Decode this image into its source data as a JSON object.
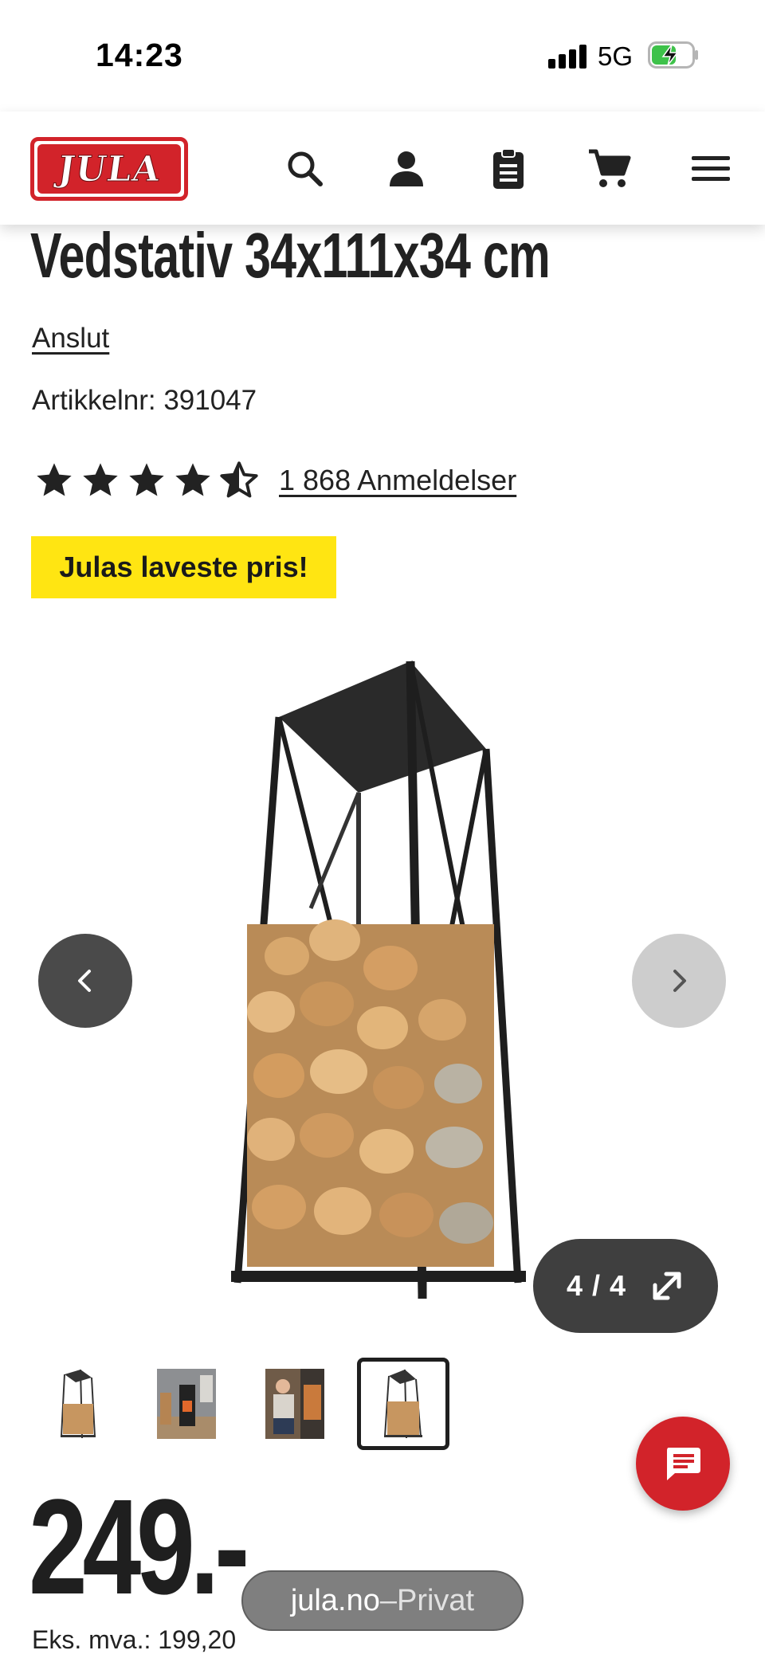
{
  "status_bar": {
    "time": "14:23",
    "network": "5G",
    "icons": [
      "signal-icon",
      "battery-charging-icon"
    ]
  },
  "header": {
    "logo_text": "JULA",
    "brand_color": "#d2232a",
    "icons": [
      "search-icon",
      "user-icon",
      "clipboard-icon",
      "cart-icon",
      "menu-icon"
    ]
  },
  "product": {
    "title": "Vedstativ 34x111x34 cm",
    "brand_link": "Anslut",
    "sku_label": "Artikkelnr: ",
    "sku_value": "391047",
    "rating_stars": 4.5,
    "reviews_text": "1 868 Anmeldelser",
    "badge_text": "Julas laveste pris!",
    "badge_color": "#ffe512"
  },
  "gallery": {
    "counter": "4 / 4",
    "current_index": 4,
    "total": 4,
    "icons": [
      "chevron-left-icon",
      "chevron-right-icon",
      "expand-icon"
    ]
  },
  "price": {
    "amount": "249.-",
    "ex_vat_label": "Eks. mva.: ",
    "ex_vat_value": "199,20"
  },
  "chat": {
    "icon": "chat-icon"
  },
  "browser": {
    "domain": "jula.no",
    "separator": " – ",
    "mode": "Privat"
  }
}
